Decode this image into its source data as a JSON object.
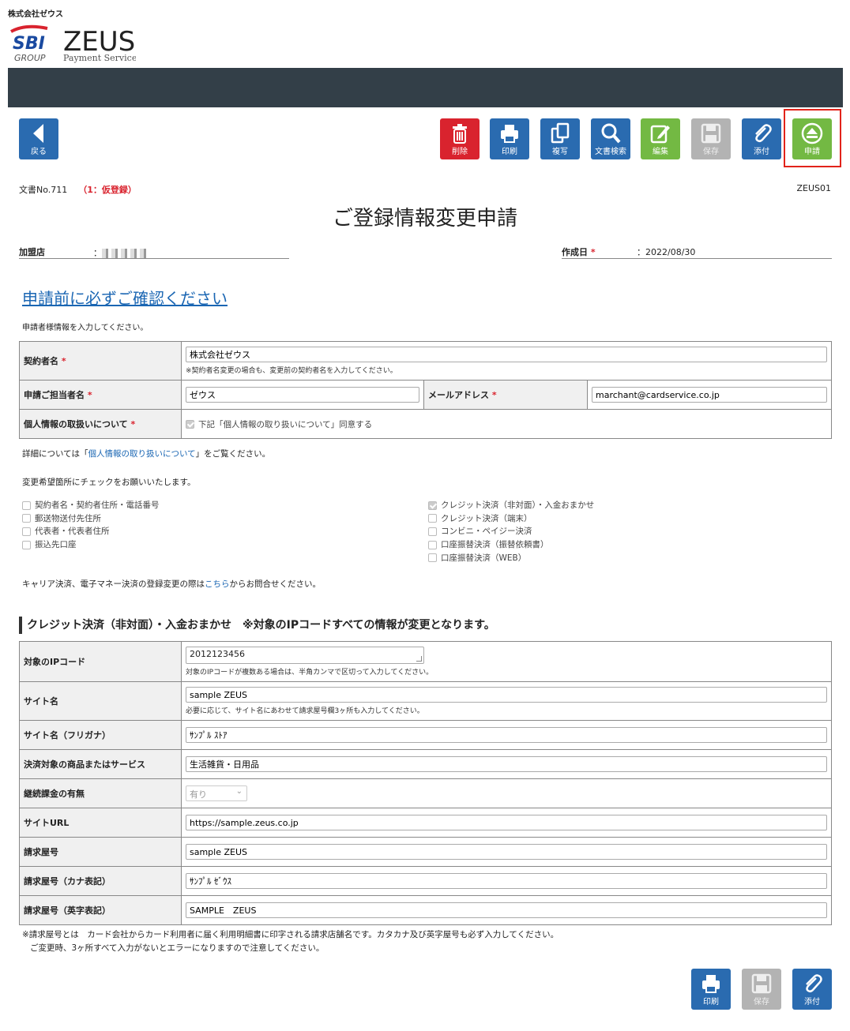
{
  "header": {
    "company": "株式会社ゼウス",
    "logo_brand": "SBI",
    "logo_group": "GROUP",
    "logo_name": "ZEUS",
    "logo_tagline": "Payment Service"
  },
  "toolbar": {
    "back": "戻る",
    "delete": "削除",
    "print": "印刷",
    "copy": "複写",
    "search": "文書検索",
    "edit": "編集",
    "save": "保存",
    "attach": "添付",
    "apply": "申請"
  },
  "colors": {
    "navbar": "#333f48",
    "blue": "#2a6bb0",
    "red": "#d9232e",
    "green": "#73b943",
    "disabled": "#b3b3b3",
    "highlight": "#e2231a"
  },
  "doc": {
    "number": "文書No.711",
    "status": "（1：仮登録）",
    "form_id": "ZEUS01",
    "title": "ご登録情報変更申請",
    "merchant_label": "加盟店",
    "merchant_value": "：",
    "date_label": "作成日",
    "date_value": "：2022/08/30",
    "required_mark": "*"
  },
  "notice": {
    "link": "申請前に必ずご確認ください",
    "intro": "申請者様情報を入力してください。"
  },
  "applicant": {
    "contractor_label": "契約者名",
    "contractor_value": "株式会社ゼウス",
    "contractor_note": "※契約者名変更の場合も、変更前の契約者名を入力してください。",
    "person_label": "申請ご担当者名",
    "person_value": "ゼウス",
    "email_label": "メールアドレス",
    "email_value": "marchant@cardservice.co.jp",
    "privacy_label": "個人情報の取扱いについて",
    "privacy_consent": "下記「個人情報の取り扱いについて」同意する"
  },
  "details": {
    "prefix": "詳細については「",
    "link": "個人情報の取り扱いについて",
    "suffix": "」をご覧ください。",
    "check_intro": "変更希望箇所にチェックをお願いいたします。"
  },
  "checks_left": [
    {
      "label": "契約者名・契約者住所・電話番号",
      "checked": false
    },
    {
      "label": "郵送物送付先住所",
      "checked": false
    },
    {
      "label": "代表者・代表者住所",
      "checked": false
    },
    {
      "label": "振込先口座",
      "checked": false
    }
  ],
  "checks_right": [
    {
      "label": "クレジット決済（非対面）・入金おまかせ",
      "checked": true
    },
    {
      "label": "クレジット決済（端末）",
      "checked": false
    },
    {
      "label": "コンビニ・ペイジー決済",
      "checked": false
    },
    {
      "label": "口座振替決済（振替依頼書）",
      "checked": false
    },
    {
      "label": "口座振替決済（WEB）",
      "checked": false
    }
  ],
  "carrier": {
    "prefix": "キャリア決済、電子マネー決済の登録変更の際は",
    "link": "こちら",
    "suffix": "からお問合せください。"
  },
  "credit": {
    "heading": "クレジット決済（非対面）・入金おまかせ　※対象のIPコードすべての情報が変更となります。",
    "ip_label": "対象のIPコード",
    "ip_value": "2012123456",
    "ip_note": "対象のIPコードが複数ある場合は、半角カンマで区切って入力してください。",
    "site_label": "サイト名",
    "site_value": "sample ZEUS",
    "site_note": "必要に応じて、サイト名にあわせて請求屋号欄3ヶ所も入力してください。",
    "site_kana_label": "サイト名（フリガナ）",
    "site_kana_value": "ｻﾝﾌﾟﾙ ｽﾄｱ",
    "product_label": "決済対象の商品またはサービス",
    "product_value": "生活雑貨・日用品",
    "recurring_label": "継続課金の有無",
    "recurring_value": "有り",
    "url_label": "サイトURL",
    "url_value": "https://sample.zeus.co.jp",
    "billing_label": "請求屋号",
    "billing_value": "sample ZEUS",
    "billing_kana_label": "請求屋号（カナ表記）",
    "billing_kana_value": "ｻﾝﾌﾟﾙ ｾﾞｳｽ",
    "billing_en_label": "請求屋号（英字表記）",
    "billing_en_value": "SAMPLE　ZEUS"
  },
  "footer": {
    "note1": "※請求屋号とは　カード会社からカード利用者に届く利用明細書に印字される請求店舗名です。カタカナ及び英字屋号も必ず入力してください。",
    "note2": "ご変更時、3ヶ所すべて入力がないとエラーになりますので注意してください。",
    "print": "印刷",
    "save": "保存",
    "attach": "添付"
  }
}
